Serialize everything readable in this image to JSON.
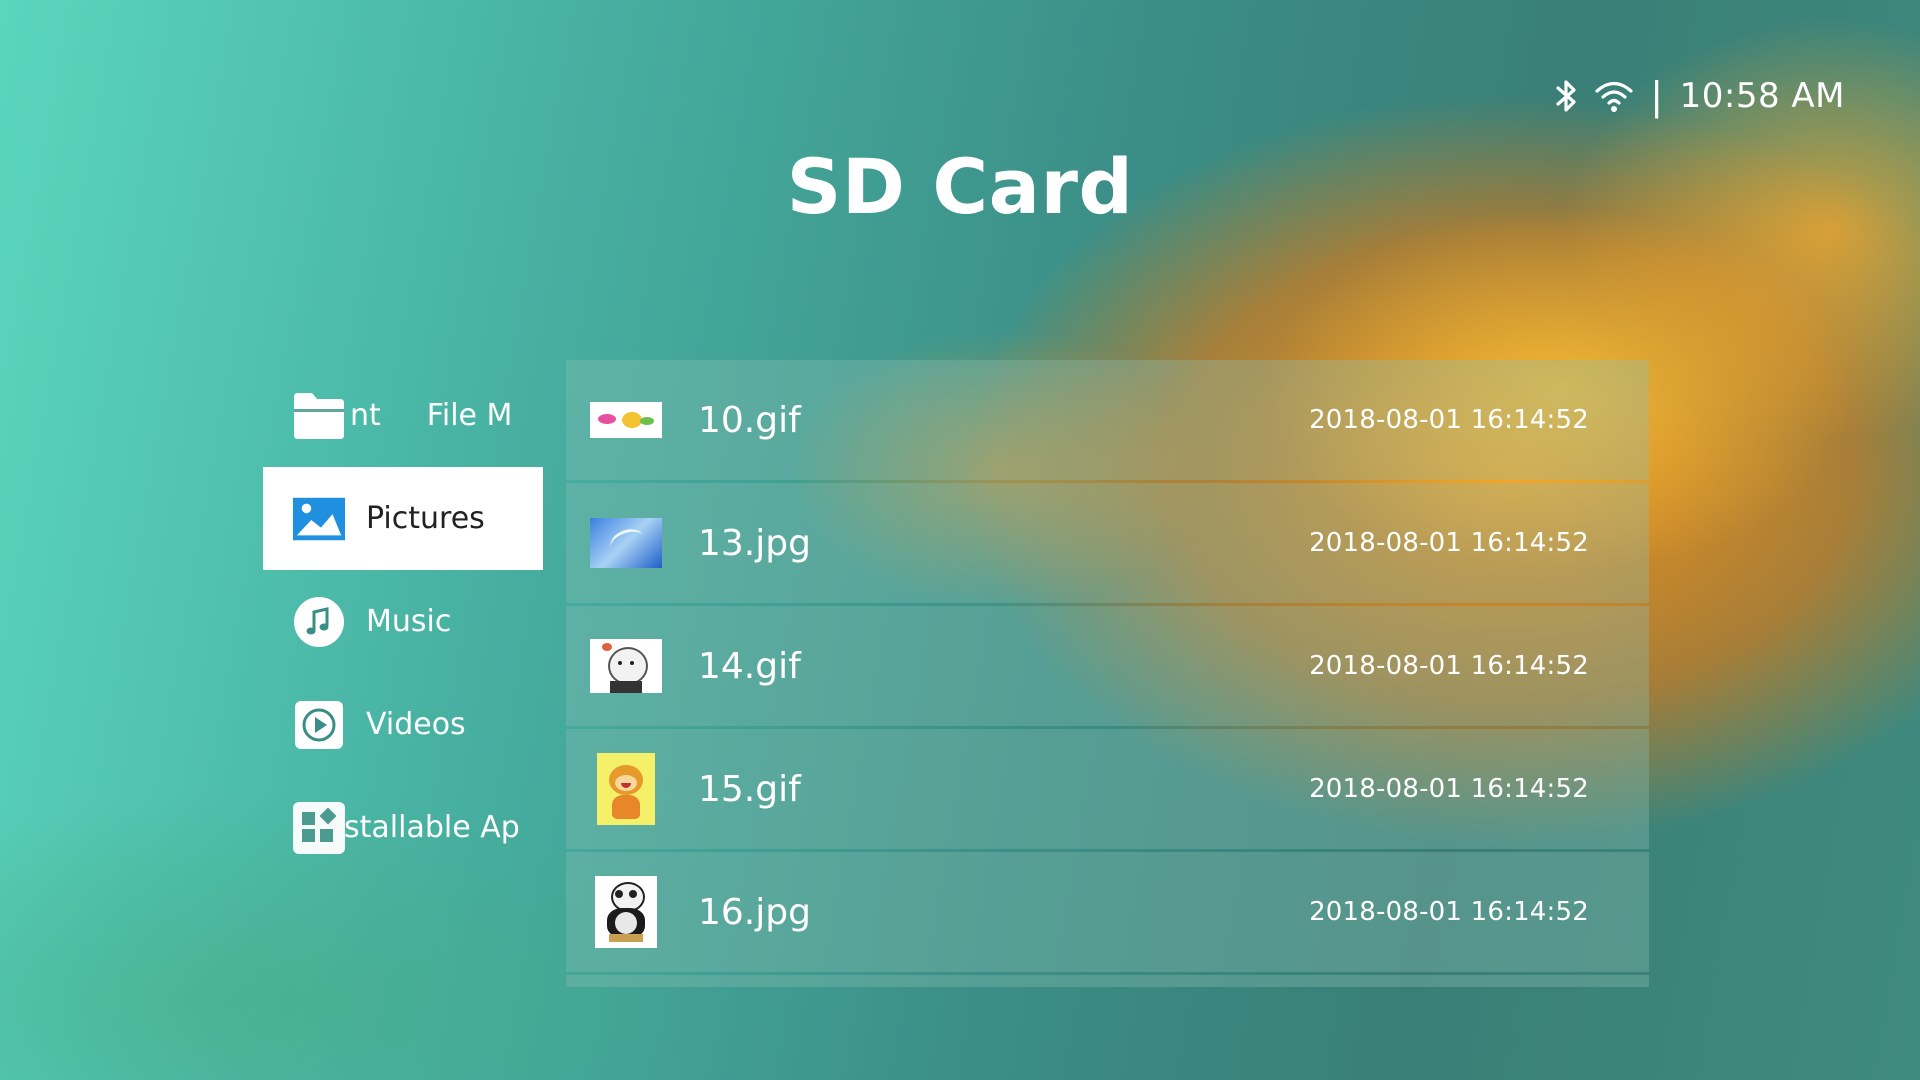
{
  "status": {
    "time": "10:58 AM",
    "separator": "|",
    "icons": [
      "bluetooth-icon",
      "wifi-icon"
    ]
  },
  "header": {
    "title": "SD Card"
  },
  "sidebar": {
    "items": [
      {
        "label": "nt",
        "label2": "File M",
        "icon": "folder-icon",
        "active": false
      },
      {
        "label": "Pictures",
        "icon": "picture-icon",
        "active": true
      },
      {
        "label": "Music",
        "icon": "music-note-icon",
        "active": false
      },
      {
        "label": "Videos",
        "icon": "play-icon",
        "active": false
      },
      {
        "label": "stallable Ap",
        "icon": "apps-grid-icon",
        "active": false
      }
    ]
  },
  "files": [
    {
      "name": "10.gif",
      "date": "2018-08-01 16:14:52"
    },
    {
      "name": "13.jpg",
      "date": "2018-08-01 16:14:52"
    },
    {
      "name": "14.gif",
      "date": "2018-08-01 16:14:52"
    },
    {
      "name": "15.gif",
      "date": "2018-08-01 16:14:52"
    },
    {
      "name": "16.jpg",
      "date": "2018-08-01 16:14:52"
    }
  ],
  "colors": {
    "active_bg": "#ffffff",
    "accent_blue": "#1f8fe0"
  }
}
